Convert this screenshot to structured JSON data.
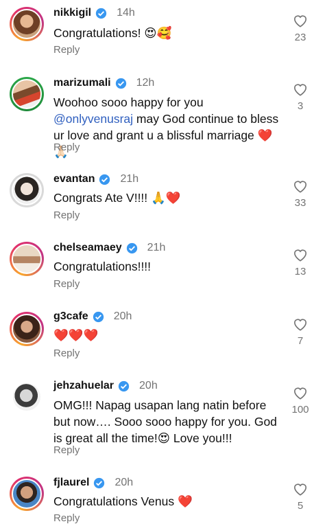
{
  "comments": [
    {
      "username": "nikkigil",
      "time": "14h",
      "text": "Congratulations! 😍🥰",
      "likes": "23",
      "reply": "Reply"
    },
    {
      "username": "marizumali",
      "time": "12h",
      "text_before": "Woohoo sooo happy for you ",
      "mention": "@onlyvenusraj",
      "text_after": " may God continue to bless ur love and grant u a blissful marriage ❤️🙏🏻",
      "likes": "3",
      "reply": "Reply"
    },
    {
      "username": "evantan",
      "time": "21h",
      "text": "Congrats Ate V!!!! 🙏❤️",
      "likes": "33",
      "reply": "Reply"
    },
    {
      "username": "chelseamaey",
      "time": "21h",
      "text": "Congratulations!!!!",
      "likes": "13",
      "reply": "Reply"
    },
    {
      "username": "g3cafe",
      "time": "20h",
      "text": "❤️❤️❤️",
      "likes": "7",
      "reply": "Reply"
    },
    {
      "username": "jehzahuelar",
      "time": "20h",
      "text": "OMG!!! Napag usapan lang natin before but now…. Sooo sooo happy for you. God is great all the time!😍 Love you!!!",
      "likes": "100",
      "reply": "Reply"
    },
    {
      "username": "fjlaurel",
      "time": "20h",
      "text": "Congratulations Venus ❤️",
      "likes": "5",
      "reply": "Reply"
    }
  ],
  "colors": {
    "verified": "#3897f0",
    "time": "#737373",
    "mention": "#2f5fbf"
  }
}
